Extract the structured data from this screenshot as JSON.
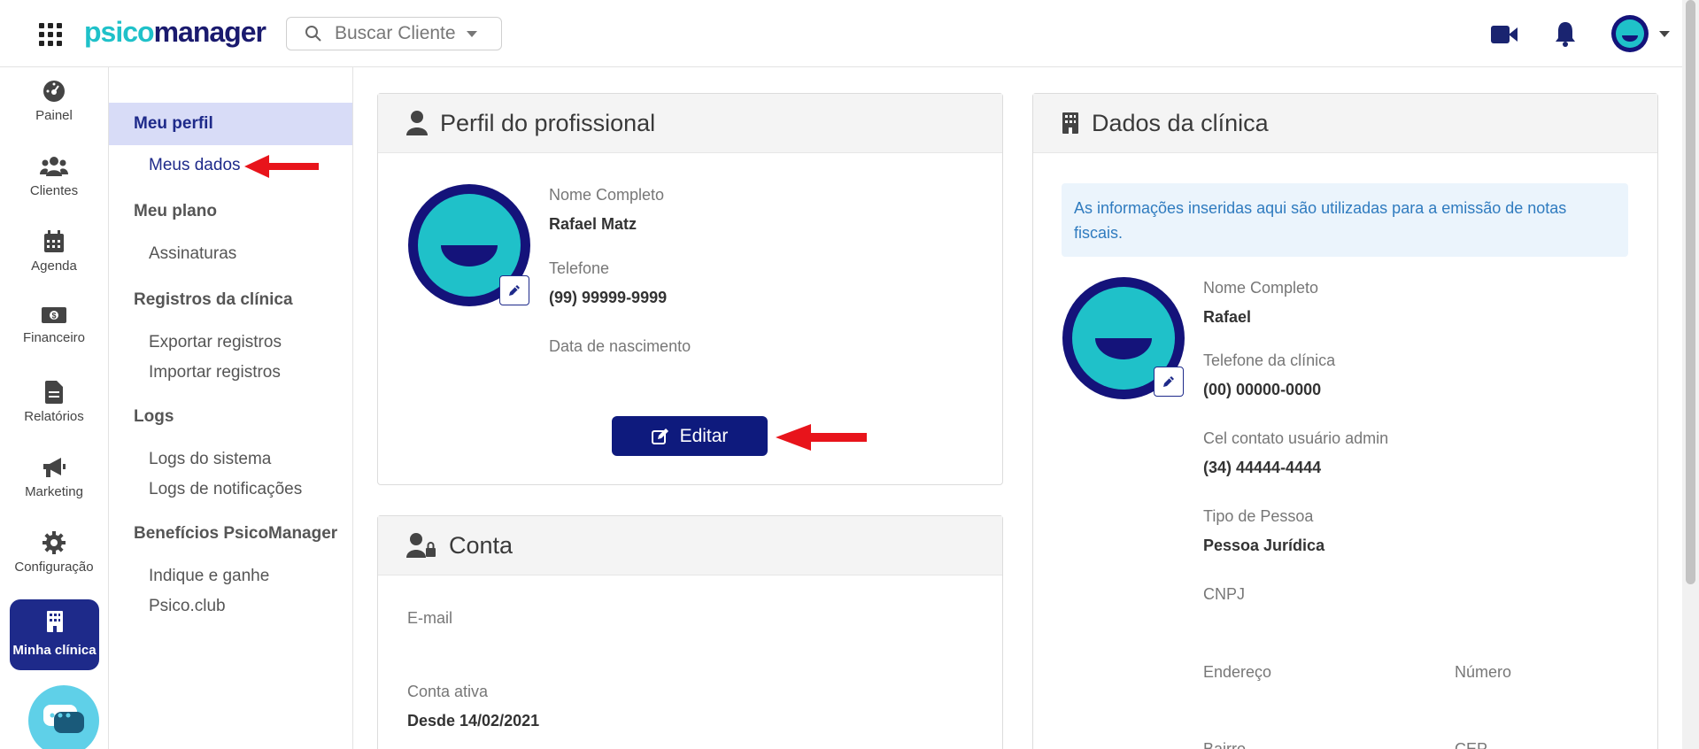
{
  "brand": {
    "logo_part1": "psico",
    "logo_part2": "manager"
  },
  "search": {
    "placeholder": "Buscar Cliente"
  },
  "leftnav": {
    "items": [
      {
        "label": "Painel",
        "icon": "dashboard-icon"
      },
      {
        "label": "Clientes",
        "icon": "users-icon"
      },
      {
        "label": "Agenda",
        "icon": "calendar-icon"
      },
      {
        "label": "Financeiro",
        "icon": "money-icon"
      },
      {
        "label": "Relatórios",
        "icon": "file-icon"
      },
      {
        "label": "Marketing",
        "icon": "megaphone-icon"
      },
      {
        "label": "Configuração",
        "icon": "gear-icon"
      }
    ],
    "active": {
      "label": "Minha clínica",
      "icon": "building-icon"
    }
  },
  "submenu": {
    "meu_perfil": "Meu perfil",
    "meus_dados": "Meus dados",
    "meu_plano": "Meu plano",
    "assinaturas": "Assinaturas",
    "registros": "Registros da clínica",
    "exportar": "Exportar registros",
    "importar": "Importar registros",
    "logs": "Logs",
    "logs_sistema": "Logs do sistema",
    "logs_notificacoes": "Logs de notificações",
    "beneficios": "Benefícios PsicoManager",
    "indique": "Indique e ganhe",
    "psicoclub": "Psico.club"
  },
  "perfil": {
    "title": "Perfil do profissional",
    "nome_label": "Nome Completo",
    "nome_value": "Rafael Matz",
    "telefone_label": "Telefone",
    "telefone_value": "(99) 99999-9999",
    "nascimento_label": "Data de nascimento",
    "edit_label": "Editar"
  },
  "conta": {
    "title": "Conta",
    "email_label": "E-mail",
    "ativa_label": "Conta ativa",
    "ativa_value": "Desde 14/02/2021"
  },
  "clinica": {
    "title": "Dados da clínica",
    "info": "As informações inseridas aqui são utilizadas para a emissão de notas fiscais.",
    "nome_label": "Nome Completo",
    "nome_value": "Rafael",
    "tel_label": "Telefone da clínica",
    "tel_value": "(00) 00000-0000",
    "cel_label": "Cel contato usuário admin",
    "cel_value": "(34) 44444-4444",
    "tipo_label": "Tipo de Pessoa",
    "tipo_value": "Pessoa Jurídica",
    "cnpj_label": "CNPJ",
    "endereco_label": "Endereço",
    "numero_label": "Número",
    "bairro_label": "Bairro",
    "cep_label": "CEP"
  },
  "colors": {
    "primary": "#0e1a7d",
    "accent": "#1fc1c9",
    "active_bg": "#d8dcf7",
    "info_bg": "#ebf4fc",
    "arrow": "#e8141b"
  }
}
